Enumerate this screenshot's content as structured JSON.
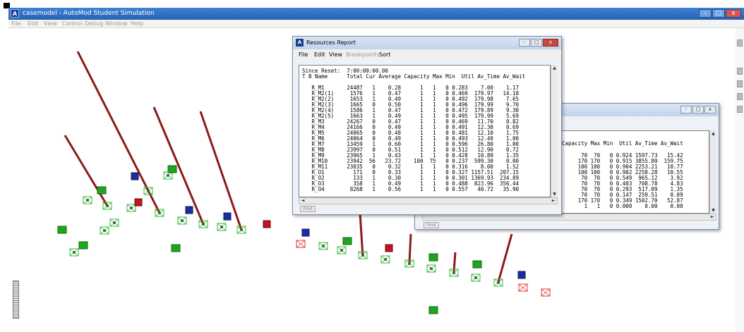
{
  "main_window": {
    "title": "casemodel - AutoMod Student Simulation",
    "logo": "A",
    "controls": [
      "-",
      "□",
      "x"
    ],
    "menu": [
      "File",
      "Edit",
      "View",
      "Control",
      "Debug",
      "Window",
      "Help"
    ]
  },
  "report_windows": {
    "front": {
      "title": "Resources Report",
      "logo": "A",
      "menu": [
        "File",
        "Edit",
        "View",
        "Breakpoints",
        "Sort"
      ],
      "controls": [
        "-",
        "□",
        "x"
      ],
      "since_reset": "Since Reset:  7:00:00:00.00",
      "header": "T B Name      Total Cur Average Capacity Max Min  Util Av_Time Av_Wait",
      "rows": [
        "   R_M1       24487   1    0.28      1   1   0 0.283    7.00    1.17",
        "   R_M2(1)     1576   1    0.47      1   1   0 0.469  179.97   14.18",
        "   R_M2(2)     1653   1    0.49      1   1   0 0.492  179.98    7.65",
        "   R_M2(3)     1665   0    0.50      1   1   0 0.496  179.99    9.70",
        "   R_M2(4)     1586   1    0.47      1   1   0 0.472  179.89    9.30",
        "   R_M2(5)     1663   1    0.49      1   1   0 0.495  179.99    5.69",
        "   R_M3       24267   0    0.47      1   1   0 0.469   11.70    0.82",
        "   R_M4       24166   0    0.49      1   1   0 0.491   12.30    0.69",
        "   R_M5       24065   0    0.48      1   1   0 0.481   12.10    1.75",
        "   R_M6       24064   0    0.49      1   1   0 0.493   12.40    1.00",
        "   R_M7       13459   1    0.60      1   1   0 0.596   26.80    1.00",
        "   R_M8       23997   0    0.51      1   1   0 0.512   12.90    0.72",
        "   R_M9       23965   1    0.43      1   1   0 0.428   10.80    1.35",
        "   R_M10      23942  56   23.72    100  75   0 0.237  599.30    0.00",
        "   R_M11      23835   0    0.32      1   1   0 0.316    8.00    1.52",
        "   R_O1         171   0    0.33      1   1   0 0.327 1157.51  207.15",
        "   R_O2         133   1    0.30      1   1   0 0.301 1369.93  234.89",
        "   R_O3         358   1    0.49      1   1   0 0.488  823.96  356.44",
        "   R_O4        8268   1    0.56      1   1   0 0.557   40.72   35.90"
      ],
      "find_label": "Find"
    },
    "back": {
      "controls": [
        "-",
        "□",
        "x"
      ],
      "header": "Capacity Max Min  Util Av_Time Av_Wait",
      "rows": [
        "",
        "      70  70   0 0.924 1597.73   15.42",
        "     170 170   0 0.915 3855.80  159.75",
        "     100 100   0 0.904 2253.21   10.77",
        "     100 100   0 0.902 2258.28   10.55",
        "      70  70   0 0.549  965.12    3.92",
        "      70  70   0 0.403  708.78    4.83",
        "      70  70   0 0.293  517.09    1.35",
        "      70  70   0 0.147  259.51    0.09",
        "     170 170   0 0.349 1502.70   52.87",
        "       1   1   0 0.000    0.00    0.00"
      ],
      "find_label": "Find"
    }
  },
  "colors": {
    "title_bar": "#2f6cc4",
    "pole": "#8b1a1a",
    "green_load": "#1fa51f",
    "blue_load": "#1a2f9e",
    "red_load": "#c0141e",
    "wire_green": "#2fbf2f",
    "wire_red": "#e03030"
  }
}
